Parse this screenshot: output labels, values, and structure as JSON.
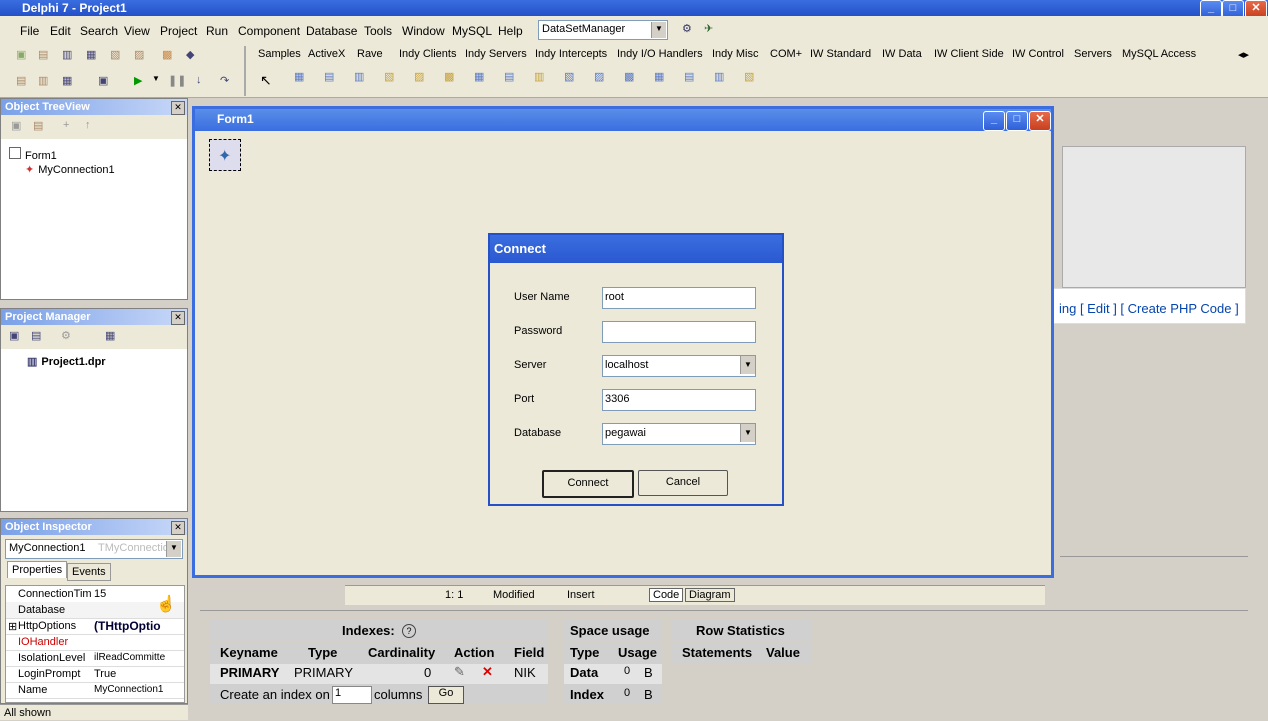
{
  "window": {
    "title": "Delphi 7 - Project1"
  },
  "menu": [
    "File",
    "Edit",
    "Search",
    "View",
    "Project",
    "Run",
    "Component",
    "Database",
    "Tools",
    "Window",
    "MySQL",
    "Help"
  ],
  "toolbar": {
    "desktop_combo": "DataSetManager",
    "palette_tabs": [
      "Samples",
      "ActiveX",
      "Rave",
      "Indy Clients",
      "Indy Servers",
      "Indy Intercepts",
      "Indy I/O Handlers",
      "Indy Misc",
      "COM+",
      "IW Standard",
      "IW Data",
      "IW Client Side",
      "IW Control",
      "Servers",
      "MySQL Access"
    ]
  },
  "treeview": {
    "title": "Object TreeView",
    "items": [
      "Form1",
      "MyConnection1"
    ]
  },
  "project_manager": {
    "title": "Project Manager",
    "items": [
      "Project1.dpr"
    ]
  },
  "inspector": {
    "title": "Object Inspector",
    "object_name": "MyConnection1",
    "object_type": "TMyConnection",
    "tabs": [
      "Properties",
      "Events"
    ],
    "props": [
      {
        "name": "ConnectionTim",
        "value": "15"
      },
      {
        "name": "Database",
        "value": ""
      },
      {
        "name": "HttpOptions",
        "value": "(THttpOptio"
      },
      {
        "name": "IOHandler",
        "value": ""
      },
      {
        "name": "IsolationLevel",
        "value": "ilReadCommitte"
      },
      {
        "name": "LoginPrompt",
        "value": "True"
      },
      {
        "name": "Name",
        "value": "MyConnection1"
      }
    ],
    "status": "All shown"
  },
  "form": {
    "title": "Form1"
  },
  "dialog": {
    "title": "Connect",
    "fields": [
      {
        "label": "User Name",
        "value": "root"
      },
      {
        "label": "Password",
        "value": ""
      },
      {
        "label": "Server",
        "value": "localhost"
      },
      {
        "label": "Port",
        "value": "3306"
      },
      {
        "label": "Database",
        "value": "pegawai"
      }
    ],
    "connect_label": "Connect",
    "cancel_label": "Cancel"
  },
  "editor_status": {
    "pos": "1: 1",
    "state": "Modified",
    "mode": "Insert",
    "tab_code": "Code",
    "tab_diagram": "Diagram"
  },
  "web": {
    "links": "ing [ Edit ] [ Create PHP Code ]",
    "indexes_title": "Indexes:",
    "index_headers": [
      "Keyname",
      "Type",
      "Cardinality",
      "Action",
      "Field"
    ],
    "index_row": {
      "keyname": "PRIMARY",
      "type": "PRIMARY",
      "cardinality": "0",
      "field": "NIK"
    },
    "create_index": {
      "prefix": "Create an index on",
      "value": "1",
      "suffix": "columns",
      "go": "Go"
    },
    "space_title": "Space usage",
    "space_headers": [
      "Type",
      "Usage"
    ],
    "space_rows": [
      {
        "type": "Data",
        "value": "0",
        "unit": "B"
      },
      {
        "type": "Index",
        "value": "0",
        "unit": "B"
      }
    ],
    "rowstats_title": "Row Statistics",
    "rowstats_headers": [
      "Statements",
      "Value"
    ]
  }
}
